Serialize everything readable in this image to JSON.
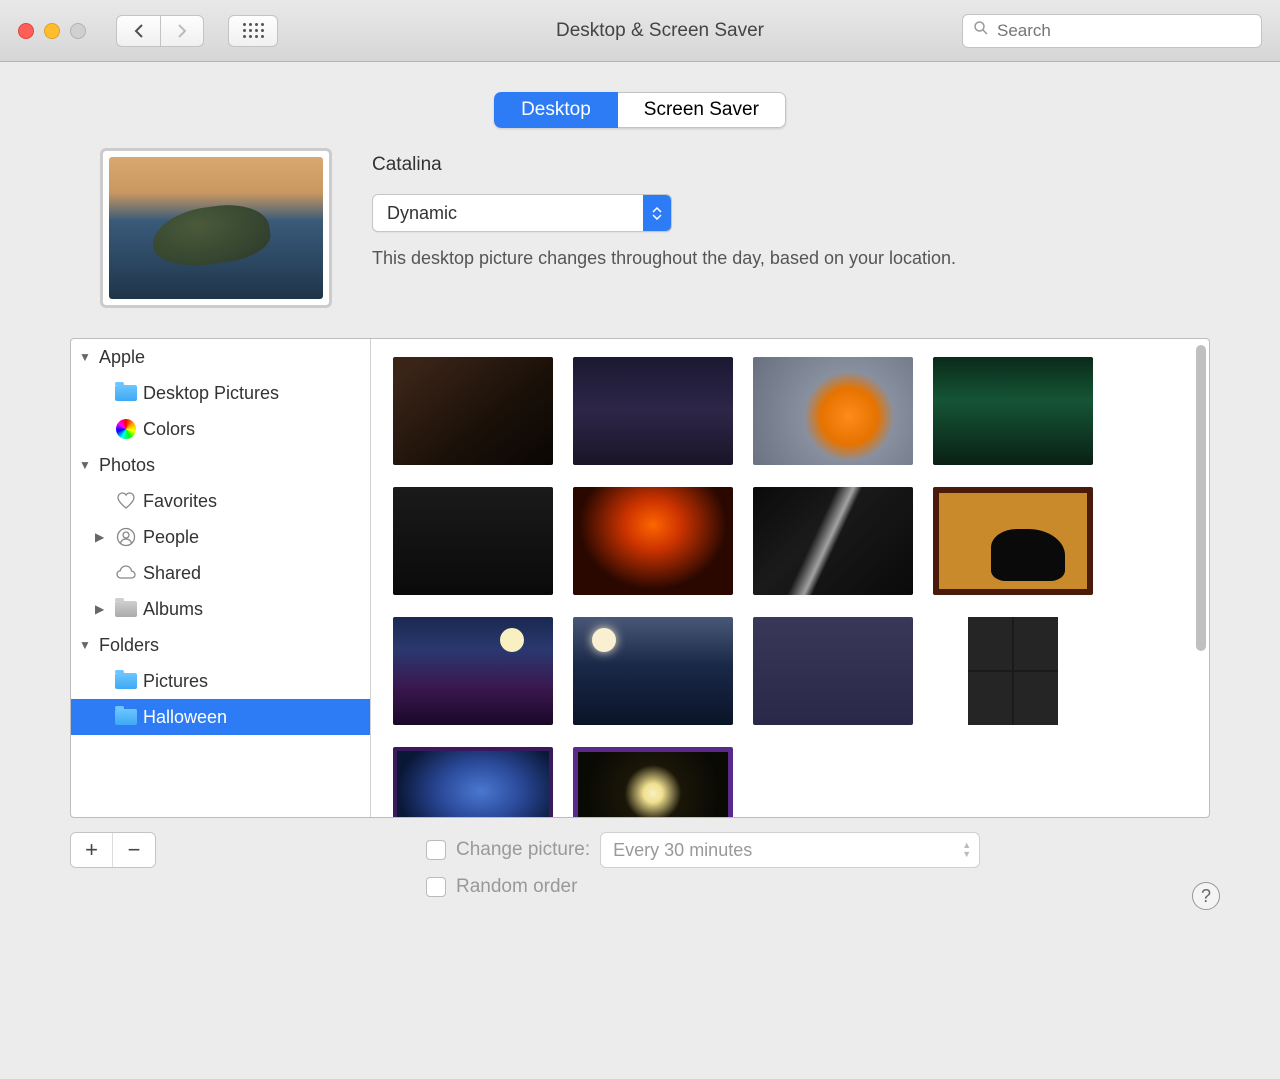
{
  "window": {
    "title": "Desktop & Screen Saver",
    "search_placeholder": "Search"
  },
  "tabs": {
    "desktop": "Desktop",
    "screensaver": "Screen Saver"
  },
  "wallpaper": {
    "name": "Catalina",
    "mode": "Dynamic",
    "description": "This desktop picture changes throughout the day, based on your location."
  },
  "sidebar": {
    "apple": {
      "label": "Apple",
      "desktop_pictures": "Desktop Pictures",
      "colors": "Colors"
    },
    "photos": {
      "label": "Photos",
      "favorites": "Favorites",
      "people": "People",
      "shared": "Shared",
      "albums": "Albums"
    },
    "folders": {
      "label": "Folders",
      "pictures": "Pictures",
      "halloween": "Halloween"
    }
  },
  "controls": {
    "change_picture": "Change picture:",
    "interval": "Every 30 minutes",
    "random_order": "Random order",
    "help": "?"
  },
  "addremove": {
    "plus": "+",
    "minus": "−"
  }
}
